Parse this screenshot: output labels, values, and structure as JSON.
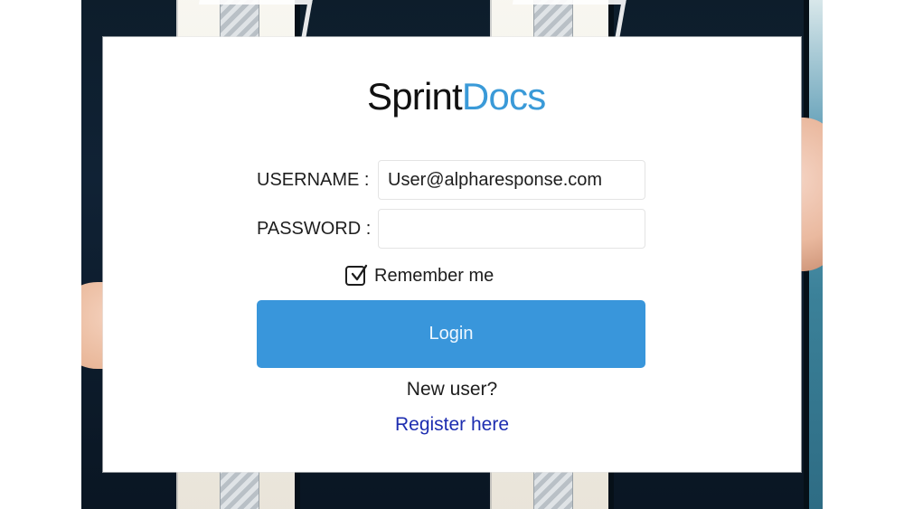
{
  "brand": {
    "name_part_1": "Sprint",
    "name_part_2": "Docs",
    "colors": {
      "primary_text": "#111111",
      "accent_blue": "#3a9ad8",
      "button_blue": "#3996db",
      "link_blue": "#1d2db0"
    }
  },
  "login_form": {
    "username_label": "USERNAME :",
    "username_value": "User@alpharesponse.com",
    "password_label": "PASSWORD :",
    "password_value": "",
    "remember_label": "Remember me",
    "remember_checked": true,
    "login_button_label": "Login",
    "new_user_text": "New user?",
    "register_link_text": "Register here"
  },
  "icons": {
    "checkbox_check": "check-icon"
  }
}
